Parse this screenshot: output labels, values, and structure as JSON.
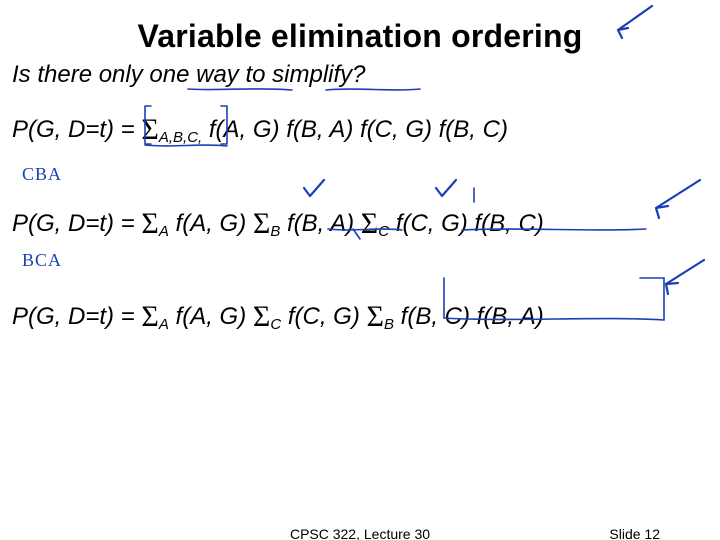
{
  "title": "Variable elimination ordering",
  "subtitle": "Is there only one way to simplify?",
  "equations": {
    "eq1": {
      "lhs": "P(G, D=t) = ",
      "sum1_sub": "A,B,C,",
      "rhs": " f(A, G) f(B, A) f(C, G) f(B, C)"
    },
    "eq2": {
      "lhs": "P(G, D=t) = ",
      "subA": "A",
      "midA": " f(A, G) ",
      "subB": "B",
      "midB": " f(B, A) ",
      "subC": "C",
      "rhs": " f(C, G) f(B, C)"
    },
    "eq3": {
      "lhs": "P(G, D=t) = ",
      "subA": "A",
      "midA": " f(A, G) ",
      "subC": "C",
      "midC": " f(C, G) ",
      "subB": "B",
      "rhs": " f(B, C) f(B, A)"
    }
  },
  "annotations": {
    "label_eq2": "CBA",
    "label_eq3": "BCA"
  },
  "footer": {
    "center": "CPSC 322, Lecture 30",
    "right": "Slide 12"
  }
}
